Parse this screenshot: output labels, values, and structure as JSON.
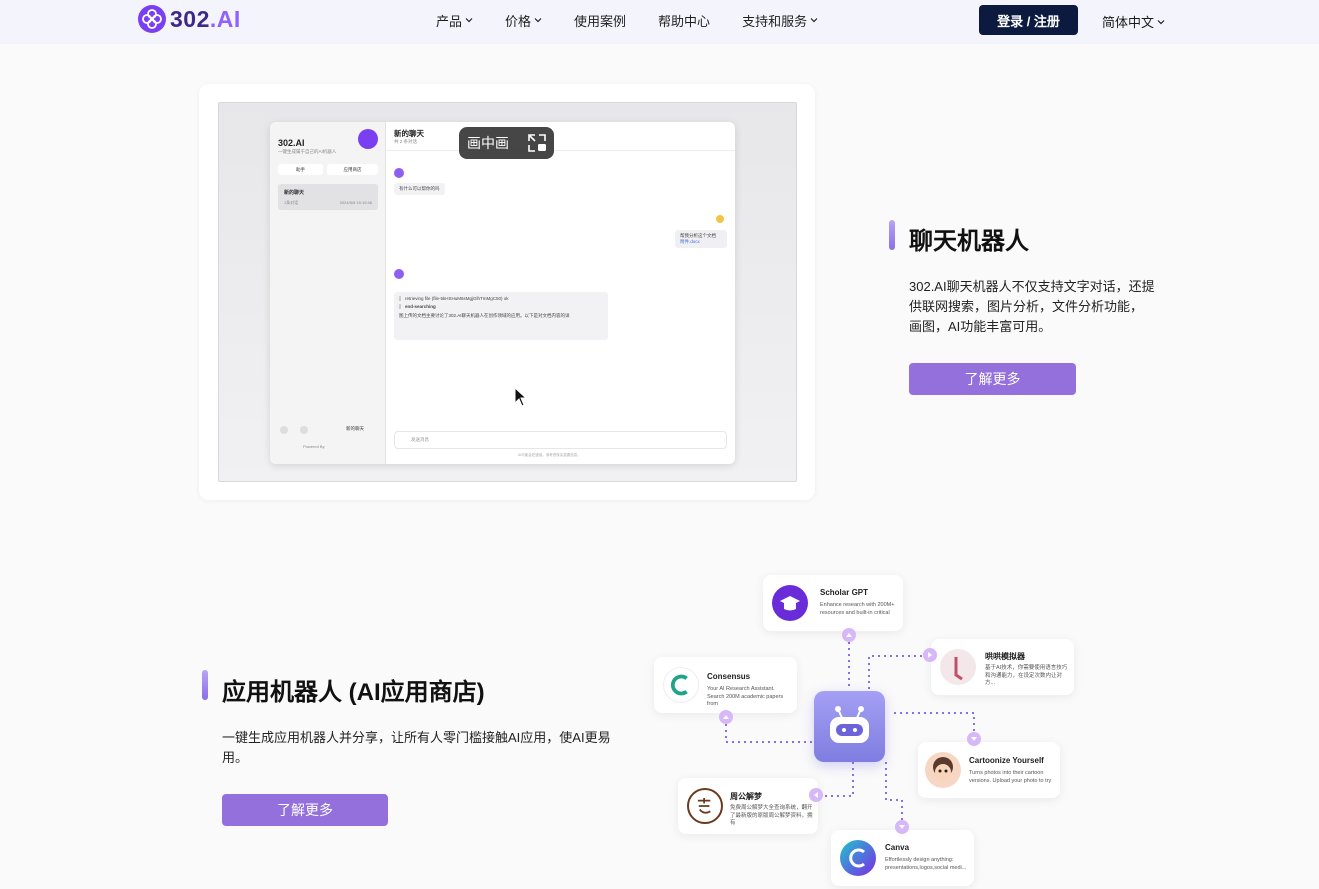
{
  "header": {
    "logo_text_main": "302",
    "logo_text_dot": ".AI",
    "menu": [
      {
        "label": "产品",
        "has_dropdown": true
      },
      {
        "label": "价格",
        "has_dropdown": true
      },
      {
        "label": "使用案例",
        "has_dropdown": false
      },
      {
        "label": "帮助中心",
        "has_dropdown": false
      },
      {
        "label": "支持和服务",
        "has_dropdown": true
      }
    ],
    "login_label": "登录 / 注册",
    "language_label": "简体中文"
  },
  "section_chat": {
    "title": "聊天机器人",
    "description": "302.AI聊天机器人不仅支持文字对话，还提供联网搜索，图片分析，文件分析功能，画图，AI功能丰富可用。",
    "cta_label": "了解更多",
    "screenshot": {
      "pip_label": "画中画",
      "app_title": "302.AI",
      "app_subtitle": "一键生成属于自己的AI机器人",
      "btn_1": "助手",
      "btn_2": "应用商店",
      "conv_title": "新的聊天",
      "conv_sub": "1条对话",
      "conv_date": "2024/5/8 15:19:46",
      "main_title": "新的聊天",
      "main_subtitle": "共 2 条对话",
      "msg_bot_1": "有什么可以帮你的吗",
      "msg_user_1": "帮我分析这个文档",
      "msg_user_file": "附件.docx",
      "msg_bot_2_a": "retrieving file (file-5kHSHuM6sMgjGlhTmMgC50) ok",
      "msg_bot_2_b": "end-searching",
      "msg_bot_2_c": "图上传的文档主要讨论了302.AI聊天机器人在创作领域的应用。以下是对文档内容的详",
      "new_chat_btn": "新的聊天",
      "powered_by": "Powered By",
      "input_placeholder": "发送消息",
      "footer_note": "AI可能会犯错误，请考虑核实重要信息。"
    }
  },
  "section_app": {
    "title": "应用机器人 (AI应用商店)",
    "description": "一键生成应用机器人并分享，让所有人零门槛接触AI应用，使AI更易用。",
    "cta_label": "了解更多",
    "nodes": {
      "scholar": {
        "name": "Scholar GPT",
        "desc": "Enhance research with 200M+ resources and built-in critical"
      },
      "consensus": {
        "name": "Consensus",
        "desc": "Your AI Research Assistant. Search 200M academic papers from"
      },
      "honghong": {
        "name": "哄哄模拟器",
        "desc": "基于AI技术，你需要使用语言技巧和沟通能力，在设定次数内让对方..."
      },
      "cartoon": {
        "name": "Cartoonize Yourself",
        "desc": "Turns photos into their cartoon versions. Upload your photo to try"
      },
      "zhougong": {
        "name": "周公解梦",
        "desc": "免费周公解梦大全查询系统，翻开了最新版的原版周公解梦资料，拥有"
      },
      "canva": {
        "name": "Canva",
        "desc": "Effortlessly design anything: presentations,logos,social medi..."
      }
    }
  },
  "colors": {
    "accent": "#9370db",
    "login_bg": "#0b1a3e",
    "nav_bg": "#f4f4fc"
  }
}
